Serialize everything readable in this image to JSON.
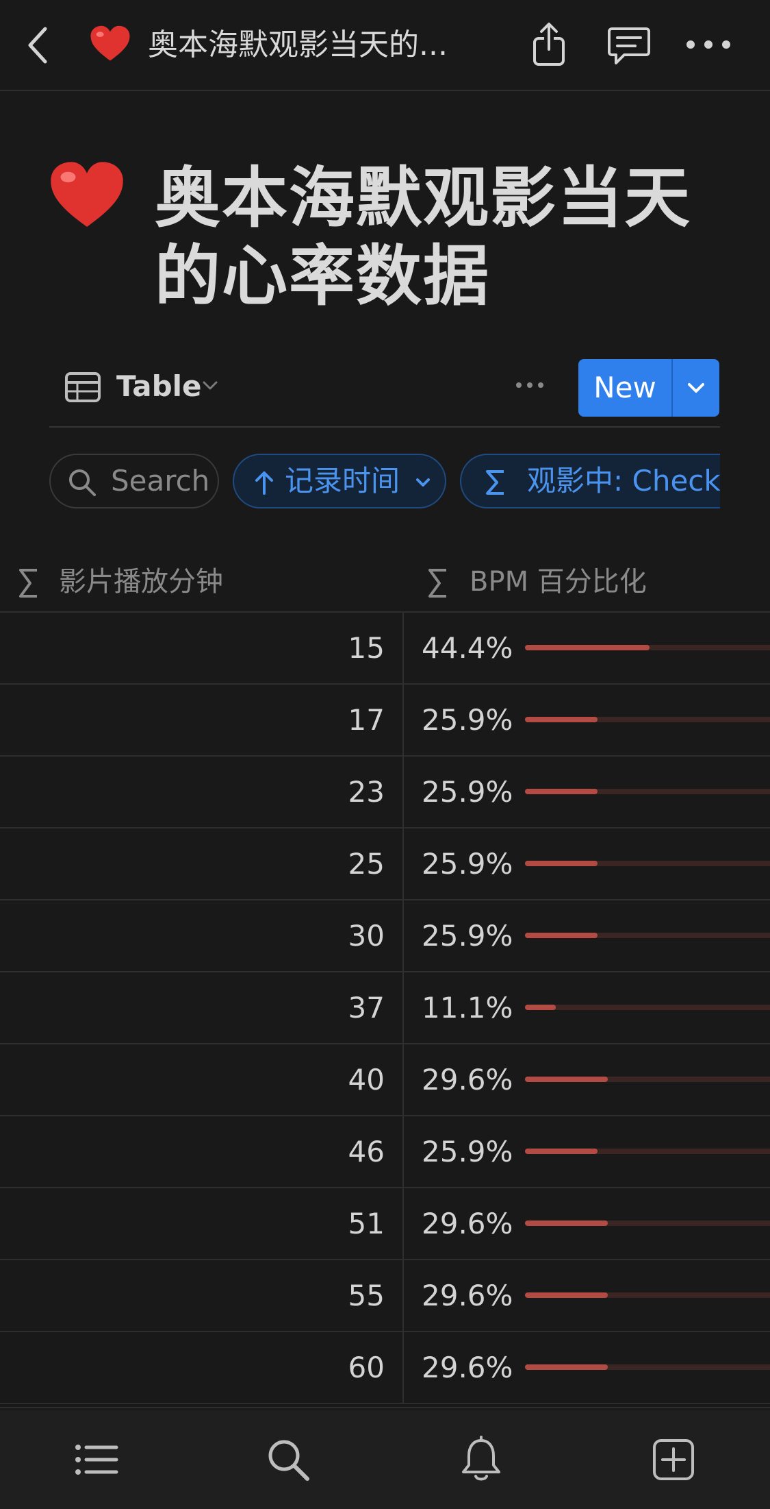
{
  "topbar": {
    "title": "奥本海默观影当天的...",
    "icons": [
      "back-icon",
      "heart-emoji",
      "share-icon",
      "comment-icon",
      "more-icon"
    ]
  },
  "page": {
    "emoji": "❤️",
    "title": "奥本海默观影当天的心率数据"
  },
  "view": {
    "label": "Table",
    "new_label": "New"
  },
  "filters": {
    "search_label": "Search",
    "sort_label": "记录时间",
    "filter_label": "观影中: Checke"
  },
  "table": {
    "columns": [
      "影片播放分钟",
      "BPM 百分比化"
    ],
    "rows": [
      {
        "minute": "15",
        "pct_label": "44.4%",
        "pct": 0.444
      },
      {
        "minute": "17",
        "pct_label": "25.9%",
        "pct": 0.259
      },
      {
        "minute": "23",
        "pct_label": "25.9%",
        "pct": 0.259
      },
      {
        "minute": "25",
        "pct_label": "25.9%",
        "pct": 0.259
      },
      {
        "minute": "30",
        "pct_label": "25.9%",
        "pct": 0.259
      },
      {
        "minute": "37",
        "pct_label": "11.1%",
        "pct": 0.111
      },
      {
        "minute": "40",
        "pct_label": "29.6%",
        "pct": 0.296
      },
      {
        "minute": "46",
        "pct_label": "25.9%",
        "pct": 0.259
      },
      {
        "minute": "51",
        "pct_label": "29.6%",
        "pct": 0.296
      },
      {
        "minute": "55",
        "pct_label": "29.6%",
        "pct": 0.296
      },
      {
        "minute": "60",
        "pct_label": "29.6%",
        "pct": 0.296
      }
    ]
  },
  "tabbar": {
    "items": [
      "list-icon",
      "search-icon",
      "bell-icon",
      "new-page-icon"
    ]
  },
  "colors": {
    "background": "#191919",
    "accent_blue": "#2f80ed",
    "progress_red": "#b34b45",
    "progress_track": "#3b2523"
  }
}
